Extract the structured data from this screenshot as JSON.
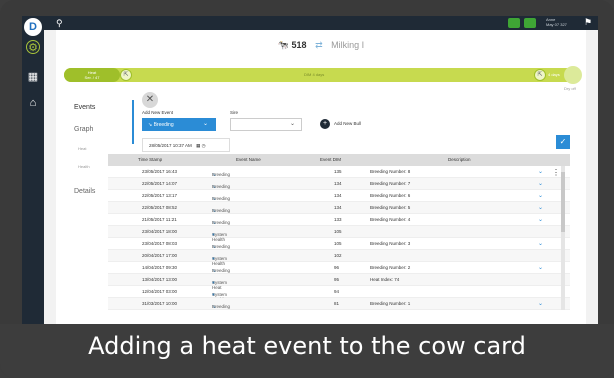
{
  "topbar": {
    "search_icon": "search-icon",
    "user_line1": "Anne",
    "user_line2": "May 07 327",
    "flag_icon": "flag-icon"
  },
  "header": {
    "cow_number": "518",
    "cow_icon": "cow-icon",
    "status": "Milking I"
  },
  "timeline": {
    "start_label_1": "Heat",
    "start_label_2": "Ser. / 47",
    "middle_label": "DIM 4 days",
    "end_label": "Dry-off",
    "right_label": "4 days",
    "end_small": "Dry off"
  },
  "sidebar": {
    "items": [
      {
        "label": "Events"
      },
      {
        "label": "Graph"
      },
      {
        "label": "Heat"
      },
      {
        "label": "Health"
      },
      {
        "label": "Details"
      }
    ]
  },
  "form": {
    "add_new_event_label": "Add New Event",
    "event_type": "Breeding",
    "sire_label": "Sire",
    "sire_value": "",
    "add_new_bull": "Add New Bull",
    "datetime": "28/05/2017 10:37 AM"
  },
  "table": {
    "headers": [
      "Time Stamp",
      "Event Name",
      "Event DIM",
      "Description"
    ],
    "rows": [
      {
        "ts": "23/05/2017 16:43",
        "event": "Breeding",
        "dim": "135",
        "desc": "Breeding Number: 8",
        "chev": true
      },
      {
        "ts": "22/05/2017 14:07",
        "event": "Breeding",
        "dim": "134",
        "desc": "Breeding Number: 7",
        "chev": true
      },
      {
        "ts": "22/05/2017 13:17",
        "event": "Breeding",
        "dim": "134",
        "desc": "Breeding Number: 6",
        "chev": true
      },
      {
        "ts": "22/05/2017 08:52",
        "event": "Breeding",
        "dim": "134",
        "desc": "Breeding Number: 5",
        "chev": true
      },
      {
        "ts": "21/05/2017 11:21",
        "event": "Breeding",
        "dim": "133",
        "desc": "Breeding Number: 4",
        "chev": true
      },
      {
        "ts": "23/04/2017 18:00",
        "event": "System Health",
        "dim": "105",
        "desc": "",
        "chev": false
      },
      {
        "ts": "23/04/2017 08:03",
        "event": "Breeding",
        "dim": "105",
        "desc": "Breeding Number: 3",
        "chev": true
      },
      {
        "ts": "20/04/2017 17:00",
        "event": "System Health",
        "dim": "102",
        "desc": "",
        "chev": false
      },
      {
        "ts": "14/04/2017 09:30",
        "event": "Breeding",
        "dim": "96",
        "desc": "Breeding Number: 2",
        "chev": true
      },
      {
        "ts": "13/04/2017 13:00",
        "event": "System Heat",
        "dim": "95",
        "desc": "Heat Index: 74",
        "chev": false
      },
      {
        "ts": "12/04/2017 03:00",
        "event": "System Health",
        "dim": "94",
        "desc": "",
        "chev": false
      },
      {
        "ts": "31/03/2017 10:00",
        "event": "Breeding",
        "dim": "81",
        "desc": "Breeding Number: 1",
        "chev": true
      }
    ]
  },
  "caption": "Adding a heat event to the cow card"
}
